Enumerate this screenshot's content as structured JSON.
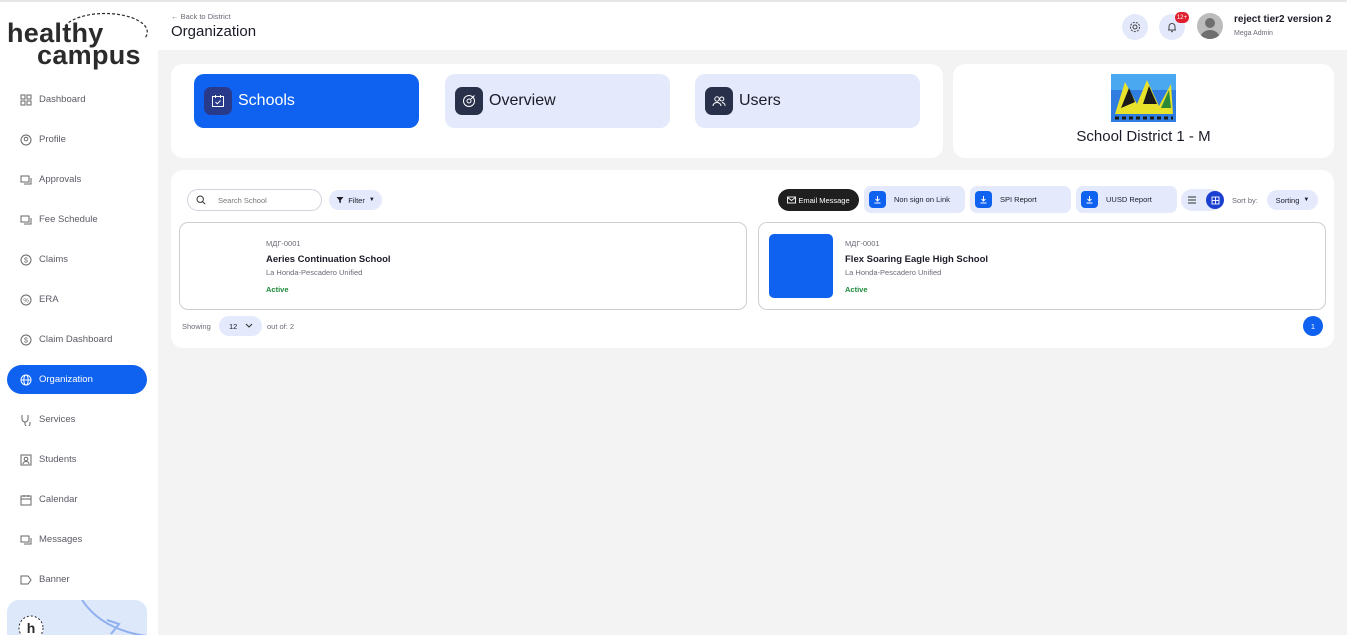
{
  "brand": {
    "line1": "healthy",
    "line2": "campus"
  },
  "sidebar": {
    "items": [
      {
        "label": "Dashboard",
        "icon": "grid-icon"
      },
      {
        "label": "Profile",
        "icon": "user-circle-icon"
      },
      {
        "label": "Approvals",
        "icon": "chat-icon"
      },
      {
        "label": "Fee Schedule",
        "icon": "chat-icon"
      },
      {
        "label": "Claims",
        "icon": "dollar-circle-icon"
      },
      {
        "label": "ERA",
        "icon": "percent-icon"
      },
      {
        "label": "Claim Dashboard",
        "icon": "dollar-circle-icon"
      },
      {
        "label": "Organization",
        "icon": "globe-icon",
        "active": true
      },
      {
        "label": "Services",
        "icon": "stethoscope-icon"
      },
      {
        "label": "Students",
        "icon": "id-card-icon"
      },
      {
        "label": "Calendar",
        "icon": "calendar-icon"
      },
      {
        "label": "Messages",
        "icon": "chat-icon"
      },
      {
        "label": "Banner",
        "icon": "banner-icon"
      }
    ]
  },
  "header": {
    "back_label": "Back to District",
    "title": "Organization",
    "notifications_count": "12+",
    "user_name": "reject tier2 version 2",
    "user_role": "Mega Admin"
  },
  "tabs": [
    {
      "label": "Schools",
      "active": true
    },
    {
      "label": "Overview",
      "active": false
    },
    {
      "label": "Users",
      "active": false
    }
  ],
  "district": {
    "name": "School District 1 - M"
  },
  "toolbar": {
    "search_placeholder": "Search School",
    "filter_label": "Filter",
    "email_label": "Email Message",
    "non_sign_label": "Non sign on Link",
    "spi_label": "SPI Report",
    "uusd_label": "UUSD Report",
    "sort_by_label": "Sort by:",
    "sort_value": "Sorting"
  },
  "schools": [
    {
      "code": "МДГ-0001",
      "name": "Aeries Continuation School",
      "district": "La Honda-Pescadero Unified",
      "status": "Active",
      "thumb_color": "#ffffff"
    },
    {
      "code": "МДГ-0001",
      "name": "Flex Soaring Eagle High School",
      "district": "La Honda-Pescadero Unified",
      "status": "Active",
      "thumb_color": "#0f62f0"
    }
  ],
  "pagination": {
    "showing_label": "Showing",
    "per_page": "12",
    "out_of_label": "out of: 2",
    "current_page": "1"
  }
}
